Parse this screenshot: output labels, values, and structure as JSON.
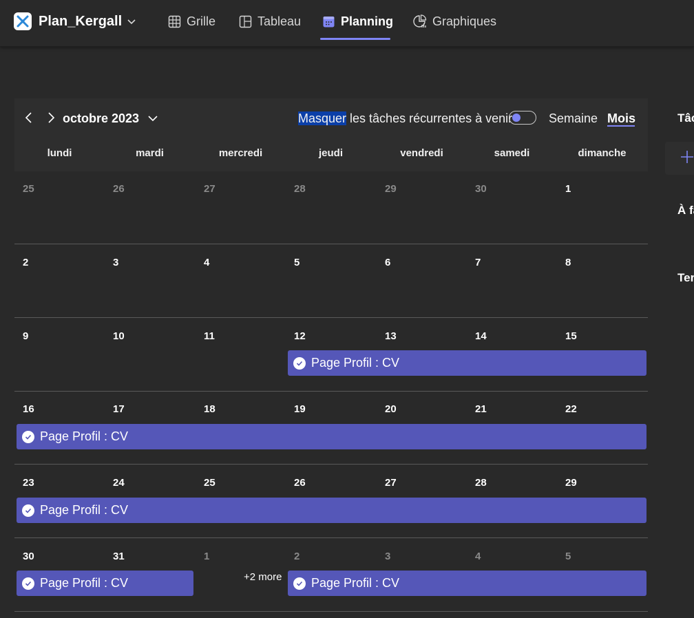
{
  "app": {
    "title": "Plan_Kergall"
  },
  "tabs": [
    {
      "label": "Grille",
      "icon": "grid-icon"
    },
    {
      "label": "Tableau",
      "icon": "board-icon"
    },
    {
      "label": "Planning",
      "icon": "calendar-icon",
      "active": true
    },
    {
      "label": "Graphiques",
      "icon": "chart-icon"
    }
  ],
  "calendar": {
    "month_label": "octobre 2023",
    "recurring_highlight": "Masquer",
    "recurring_rest": " les tâches récurrentes à venir",
    "recurring_toggle_on": false,
    "view_week": "Semaine",
    "view_month": "Mois",
    "selected_view": "Mois",
    "weekdays": [
      "lundi",
      "mardi",
      "mercredi",
      "jeudi",
      "vendredi",
      "samedi",
      "dimanche"
    ],
    "weeks": [
      [
        "25",
        "26",
        "27",
        "28",
        "29",
        "30",
        "1"
      ],
      [
        "2",
        "3",
        "4",
        "5",
        "6",
        "7",
        "8"
      ],
      [
        "9",
        "10",
        "11",
        "12",
        "13",
        "14",
        "15"
      ],
      [
        "16",
        "17",
        "18",
        "19",
        "20",
        "21",
        "22"
      ],
      [
        "23",
        "24",
        "25",
        "26",
        "27",
        "28",
        "29"
      ],
      [
        "30",
        "31",
        "1",
        "2",
        "3",
        "4",
        "5"
      ]
    ],
    "events": {
      "week3": "Page Profil : CV",
      "week4": "Page Profil : CV",
      "week5": "Page Profil : CV",
      "week6a": "Page Profil : CV",
      "week6b": "Page Profil : CV"
    },
    "more_label": "+2 more"
  },
  "side_panel": {
    "title": "Tâc",
    "section1": "À fa",
    "section2": "Ter"
  },
  "colors": {
    "accent": "#7f85f5",
    "event": "#5557b8",
    "background": "#292929"
  }
}
